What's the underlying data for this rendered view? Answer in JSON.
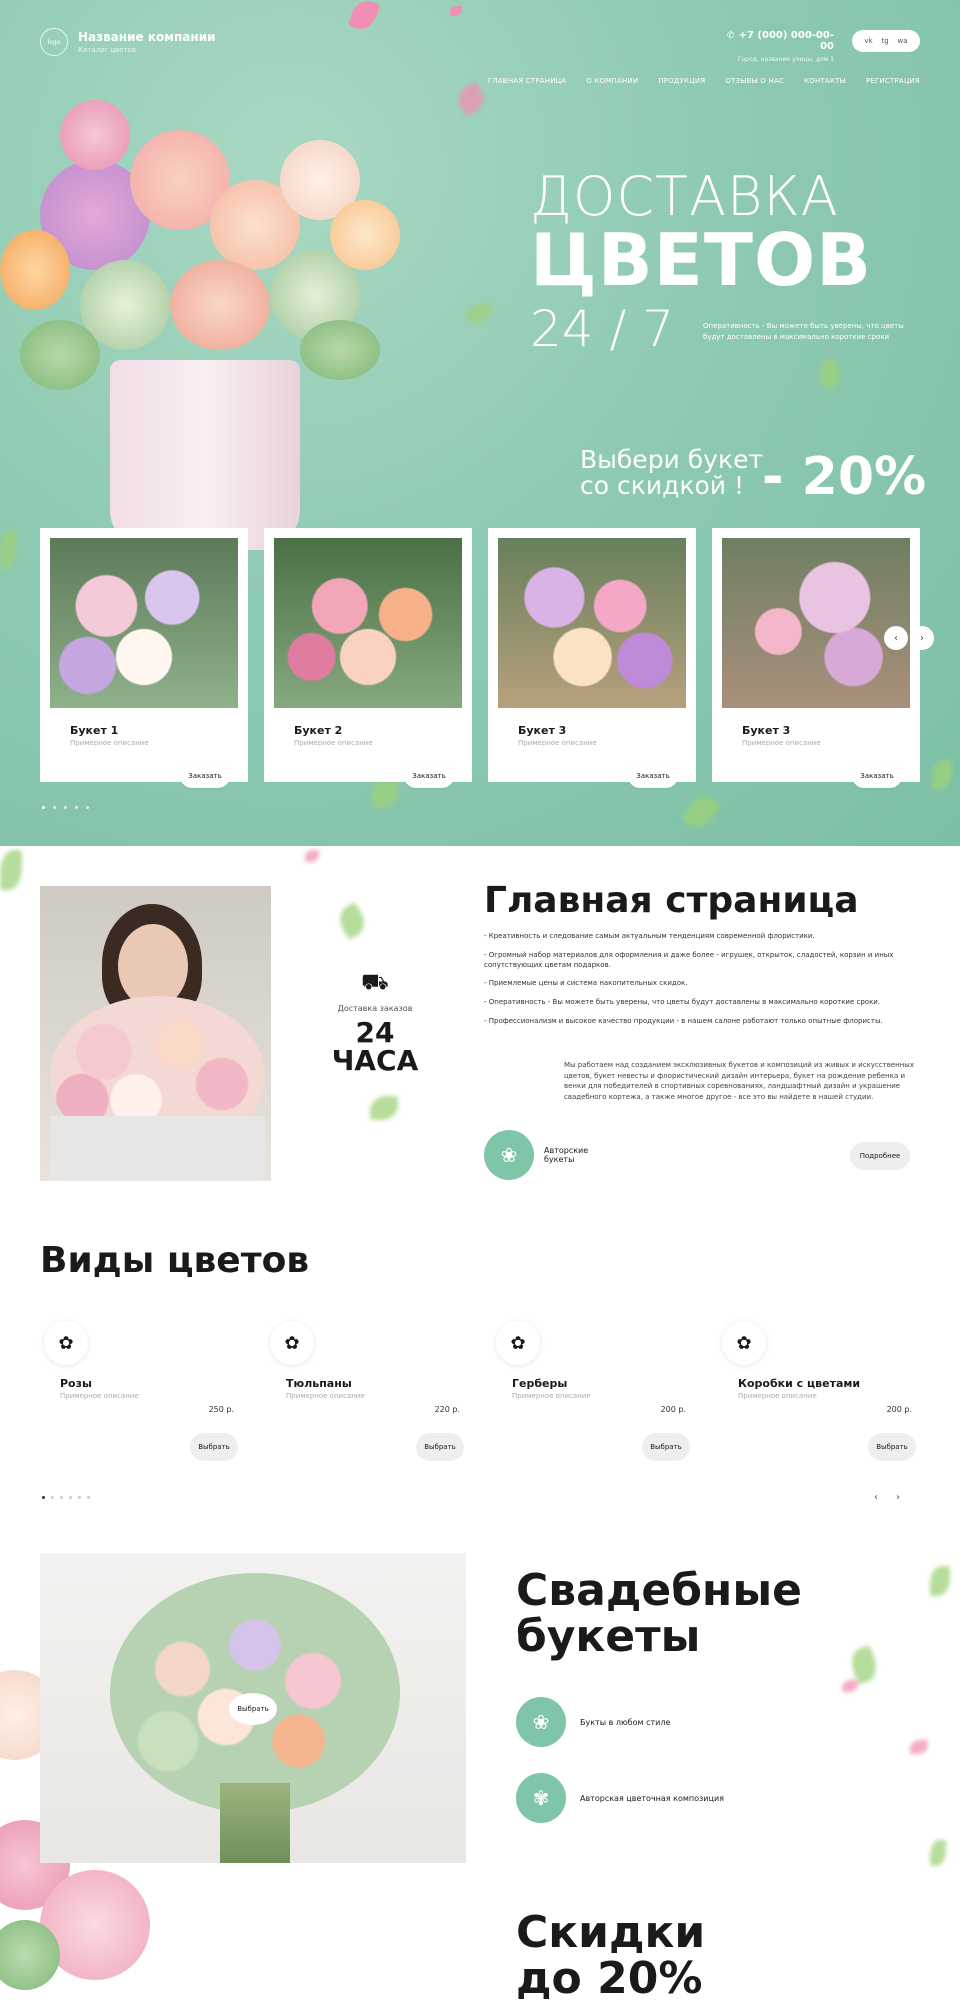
{
  "header": {
    "company_name": "Название компании",
    "company_sub": "Каталог цветов",
    "logo_text": "logo",
    "phone": "+7 (000) 000-00-00",
    "address": "Город, название улицы, дом 1",
    "social": [
      "vk",
      "tg",
      "wa"
    ]
  },
  "nav": [
    "ГЛАВНАЯ СТРАНИЦА",
    "О КОМПАНИИ",
    "ПРОДУКЦИЯ",
    "ОТЗЫВЫ О НАС",
    "КОНТАКТЫ",
    "РЕГИСТРАЦИЯ"
  ],
  "hero": {
    "line1": "ДОСТАВКА",
    "line2": "ЦВЕТОВ",
    "line3": "24 / 7",
    "note": "Оперативность - Вы можете быть уверены, что цветы будут доставлены в максимально короткие сроки",
    "promo_line1": "Выбери букет",
    "promo_line2": "со скидкой !",
    "promo_pct": "- 20%"
  },
  "products": [
    {
      "title": "Букет 1",
      "desc": "Примерное описание",
      "button": "Заказать"
    },
    {
      "title": "Букет 2",
      "desc": "Примерное описание",
      "button": "Заказать"
    },
    {
      "title": "Букет 3",
      "desc": "Примерное описание",
      "button": "Заказать"
    },
    {
      "title": "Букет 3",
      "desc": "Примерное описание",
      "button": "Заказать"
    }
  ],
  "about": {
    "delivery_label": "Доставка заказов",
    "delivery_big1": "24",
    "delivery_big2": "ЧАСА",
    "title": "Главная страница",
    "list": [
      "- Креативность и следование самым актуальным тенденциям современной флористики.",
      "- Огромный набор материалов для оформления и даже более - игрушек, открыток, сладостей, корзин и иных сопутствующих цветам подарков.",
      "- Приемлемые цены и система накопительных скидок.",
      "- Оперативность - Вы можете быть уверены, что цветы будут доставлены в максимально короткие сроки.",
      "- Профессионализм и высокое качество продукции - в нашем салоне работают только опытные флористы."
    ],
    "paragraph": "Мы работаем над созданием эксклюзивных букетов и композиций из живых и искусственных цветов, букет невесты и флористический дизайн интерьера, букет на рождение ребенка и венки для победителей в спортивных соревнованиях, ландшафтный дизайн и украшение свадебного кортежа, а также многое другое - все это вы найдете в нашей студии.",
    "author_label": "Авторские букеты",
    "more_button": "Подробнее"
  },
  "types": {
    "title": "Виды цветов",
    "items": [
      {
        "name": "Розы",
        "desc": "Примерное описание",
        "price": "250 р.",
        "button": "Выбрать"
      },
      {
        "name": "Тюльпаны",
        "desc": "Примерное описание",
        "price": "220 р.",
        "button": "Выбрать"
      },
      {
        "name": "Герберы",
        "desc": "Примерное описание",
        "price": "200 р.",
        "button": "Выбрать"
      },
      {
        "name": "Коробки с цветами",
        "desc": "Примерное описание",
        "price": "200 р.",
        "button": "Выбрать"
      }
    ]
  },
  "wedding": {
    "title1": "Свадебные",
    "title2": "букеты",
    "choose": "Выбрать",
    "item1": "Букты в любом стиле",
    "item2": "Авторская цветочная композиция"
  },
  "sale": {
    "title1": "Скидки",
    "title2": "до 20%"
  },
  "colors": {
    "accent": "#7fc5a8",
    "hero_bg": "#8fcab2",
    "petal_pink": "#f08fb3"
  }
}
